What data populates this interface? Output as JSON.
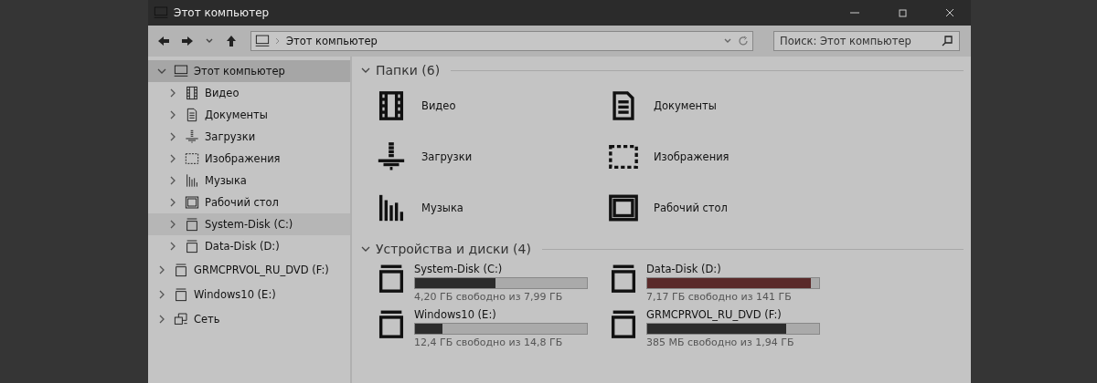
{
  "window": {
    "title": "Этот компьютер"
  },
  "toolbar": {
    "address": "Этот компьютер",
    "search": {
      "placeholder": "Поиск: Этот компьютер"
    }
  },
  "sidebar": {
    "items": [
      {
        "label": "Этот компьютер",
        "kind": "computer",
        "expanded": true,
        "selected": true,
        "hovered": false,
        "children": [
          {
            "label": "Видео",
            "kind": "video",
            "expanded": false,
            "selected": false,
            "hovered": false
          },
          {
            "label": "Документы",
            "kind": "documents",
            "expanded": false,
            "selected": false,
            "hovered": false
          },
          {
            "label": "Загрузки",
            "kind": "downloads",
            "expanded": false,
            "selected": false,
            "hovered": false
          },
          {
            "label": "Изображения",
            "kind": "pictures",
            "expanded": false,
            "selected": false,
            "hovered": false
          },
          {
            "label": "Музыка",
            "kind": "music",
            "expanded": false,
            "selected": false,
            "hovered": false
          },
          {
            "label": "Рабочий стол",
            "kind": "desktop",
            "expanded": false,
            "selected": false,
            "hovered": false
          },
          {
            "label": "System-Disk (C:)",
            "kind": "drive",
            "expanded": false,
            "selected": false,
            "hovered": true
          },
          {
            "label": "Data-Disk (D:)",
            "kind": "drive",
            "expanded": false,
            "selected": false,
            "hovered": false
          }
        ]
      },
      {
        "label": "GRMCPRVOL_RU_DVD (F:)",
        "kind": "drive",
        "expanded": false,
        "selected": false,
        "hovered": false
      },
      {
        "label": "Windows10 (E:)",
        "kind": "drive",
        "expanded": false,
        "selected": false,
        "hovered": false
      },
      {
        "label": "Сеть",
        "kind": "network",
        "expanded": false,
        "selected": false,
        "hovered": false
      }
    ]
  },
  "folders": {
    "title": "Папки (6)",
    "expanded": true,
    "items": [
      {
        "label": "Видео",
        "kind": "video"
      },
      {
        "label": "Документы",
        "kind": "documents"
      },
      {
        "label": "Загрузки",
        "kind": "downloads"
      },
      {
        "label": "Изображения",
        "kind": "pictures"
      },
      {
        "label": "Музыка",
        "kind": "music"
      },
      {
        "label": "Рабочий стол",
        "kind": "desktop"
      }
    ]
  },
  "devices": {
    "title": "Устройства и диски (4)",
    "expanded": true,
    "items": [
      {
        "label": "System-Disk (C:)",
        "level": 0.47,
        "low_space": false,
        "free": "4,20 ГБ свободно из 7,99 ГБ"
      },
      {
        "label": "Data-Disk (D:)",
        "level": 0.95,
        "low_space": true,
        "free": "7,17 ГБ свободно из 141 ГБ"
      },
      {
        "label": "Windows10 (E:)",
        "level": 0.16,
        "low_space": false,
        "free": "12,4 ГБ свободно из 14,8 ГБ"
      },
      {
        "label": "GRMCPRVOL_RU_DVD (F:)",
        "level": 0.81,
        "low_space": false,
        "free": "385 МБ свободно из 1,94 ГБ"
      }
    ]
  }
}
